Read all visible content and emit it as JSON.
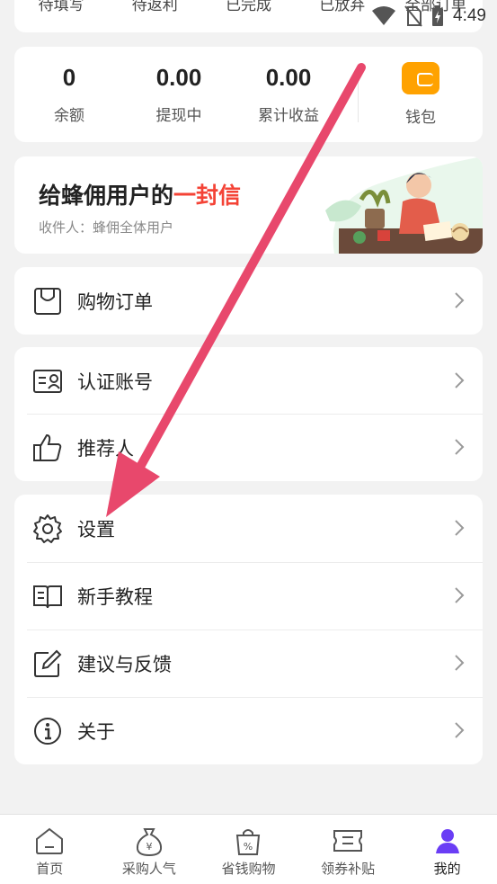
{
  "status_bar": {
    "time": "4:49"
  },
  "order_tabs": [
    "待填写",
    "待返利",
    "已完成",
    "已放弃",
    "全部订单"
  ],
  "balance": {
    "stats": [
      {
        "value": "0",
        "label": "余额"
      },
      {
        "value": "0.00",
        "label": "提现中"
      },
      {
        "value": "0.00",
        "label": "累计收益"
      }
    ],
    "wallet_label": "钱包"
  },
  "letter": {
    "title_prefix": "给蜂佣用户的",
    "title_highlight": "一封信",
    "subtitle": "收件人：蜂佣全体用户"
  },
  "menu": {
    "shopping_orders": "购物订单",
    "verify_account": "认证账号",
    "referrer": "推荐人",
    "settings": "设置",
    "tutorial": "新手教程",
    "feedback": "建议与反馈",
    "about": "关于"
  },
  "bottom_nav": [
    {
      "label": "首页",
      "icon": "home-icon"
    },
    {
      "label": "采购人气",
      "icon": "money-bag-icon"
    },
    {
      "label": "省钱购物",
      "icon": "discount-bag-icon"
    },
    {
      "label": "领券补贴",
      "icon": "coupon-icon"
    },
    {
      "label": "我的",
      "icon": "user-icon"
    }
  ],
  "colors": {
    "accent_red": "#f44336",
    "wallet_orange": "#ffa200",
    "active_nav": "#6a3df5",
    "arrow": "#e8486c"
  }
}
